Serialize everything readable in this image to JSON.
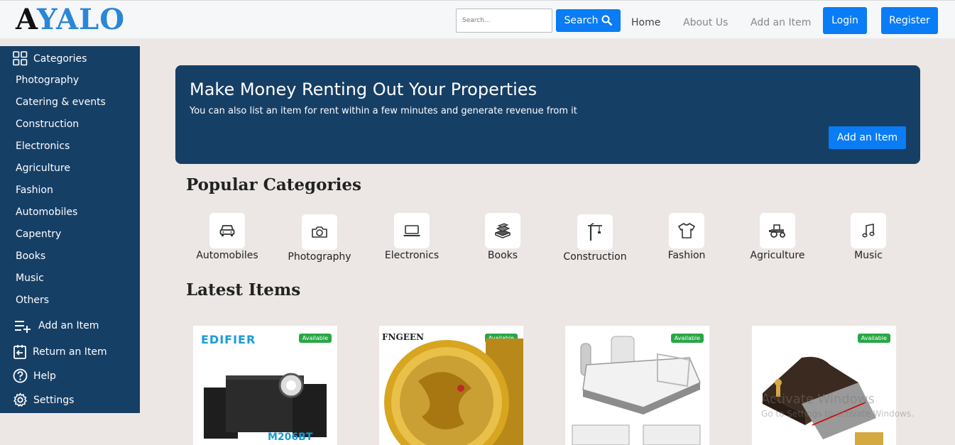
{
  "header": {
    "logo_first": "A",
    "logo_rest": "YALO",
    "search_placeholder": "Search...",
    "search_label": "Search",
    "nav": {
      "home": "Home",
      "about": "About Us",
      "add_item": "Add an Item"
    },
    "login_label": "Login",
    "register_label": "Register"
  },
  "sidebar": {
    "categories_label": "Categories",
    "items": [
      "Photography",
      "Catering & events",
      "Construction",
      "Electronics",
      "Agriculture",
      "Fashion",
      "Automobiles",
      "Capentry",
      "Books",
      "Music",
      "Others"
    ],
    "add_item": "Add an Item",
    "return_item": "Return an Item",
    "help": "Help",
    "settings": "Settings"
  },
  "banner": {
    "title": "Make Money Renting Out Your Properties",
    "subtitle": "You can also list an item for rent within a few minutes and generate revenue from it",
    "button": "Add an Item"
  },
  "popular": {
    "heading": "Popular Categories",
    "categories": [
      {
        "label": "Automobiles",
        "icon": "car-icon"
      },
      {
        "label": "Photography",
        "icon": "camera-icon"
      },
      {
        "label": "Electronics",
        "icon": "laptop-icon"
      },
      {
        "label": "Books",
        "icon": "books-icon"
      },
      {
        "label": "Construction",
        "icon": "crane-icon"
      },
      {
        "label": "Fashion",
        "icon": "shirt-icon"
      },
      {
        "label": "Agriculture",
        "icon": "tractor-icon"
      },
      {
        "label": "Music",
        "icon": "music-note-icon"
      }
    ]
  },
  "latest": {
    "heading": "Latest Items",
    "items": [
      {
        "badge": "Available",
        "brand": "EDIFIER",
        "model": "M206BT"
      },
      {
        "badge": "Available",
        "brand": "FNGEEN"
      },
      {
        "badge": "Available"
      },
      {
        "badge": "Available"
      }
    ]
  },
  "watermark": {
    "title": "Activate Windows",
    "subtitle": "Go to Settings to activate Windows."
  },
  "colors": {
    "primary": "#0a7cf5",
    "sidebar": "#163f66",
    "badge": "#28a745",
    "logo_blue": "#2a86d8"
  }
}
